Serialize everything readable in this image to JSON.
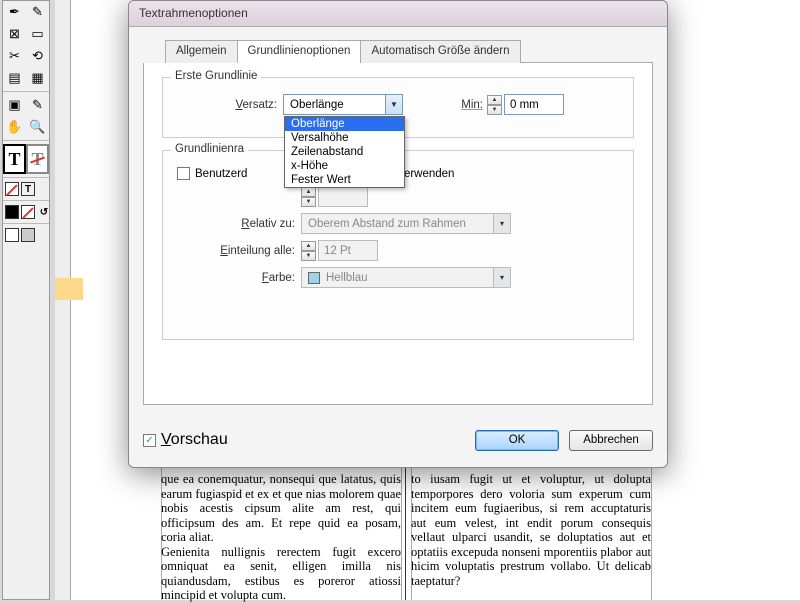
{
  "dialog": {
    "title": "Textrahmenoptionen",
    "tabs": {
      "general": "Allgemein",
      "baseline": "Grundlinienoptionen",
      "autosize": "Automatisch Größe ändern"
    },
    "group1": {
      "title": "Erste Grundlinie",
      "offset_label": "Versatz:",
      "offset_value": "Oberlänge",
      "offset_options": [
        "Oberlänge",
        "Versalhöhe",
        "Zeilenabstand",
        "x-Höhe",
        "Fester Wert"
      ],
      "min_label": "Min:",
      "min_value": "0 mm"
    },
    "group2": {
      "title_visible": "Grundlinienra",
      "checkbox_label_visible": "Benutzerd",
      "checkbox_tail": "aster verwenden",
      "relative_label": "Relativ zu:",
      "relative_value": "Oberem Abstand zum Rahmen",
      "increment_label": "Einteilung alle:",
      "increment_value": "12 Pt",
      "color_label": "Farbe:",
      "color_value": "Hellblau"
    },
    "footer": {
      "preview": "Vorschau",
      "ok": "OK",
      "cancel": "Abbrechen"
    }
  },
  "document": {
    "col_left": "que ea conemquatur, nonsequi que latatus, quis earum fugiaspid et ex et que nias molorem quae nobis acestis cipsum alite am rest, qui officipsum des am. Et repe quid ea posam, coria aliat.\nGenienita nullignis rerectem fugit excero omniquat ea senit, elligen imilla nis quiandusdam, estibus es poreror atiossi mincipid et volupta cum.",
    "col_right": "to iusam fugit ut et voluptur, ut dolupta temporpores dero voloria sum experum cum incitem eum fugiaeribus, si rem accuptaturis aut eum velest, int endit porum consequis vellaut ulparci usandit, se doluptatios aut et optatiis excepuda nonseni mporentiis plabor aut hicim voluptatis prestrum vollabo. Ut delicab taeptatur?"
  }
}
